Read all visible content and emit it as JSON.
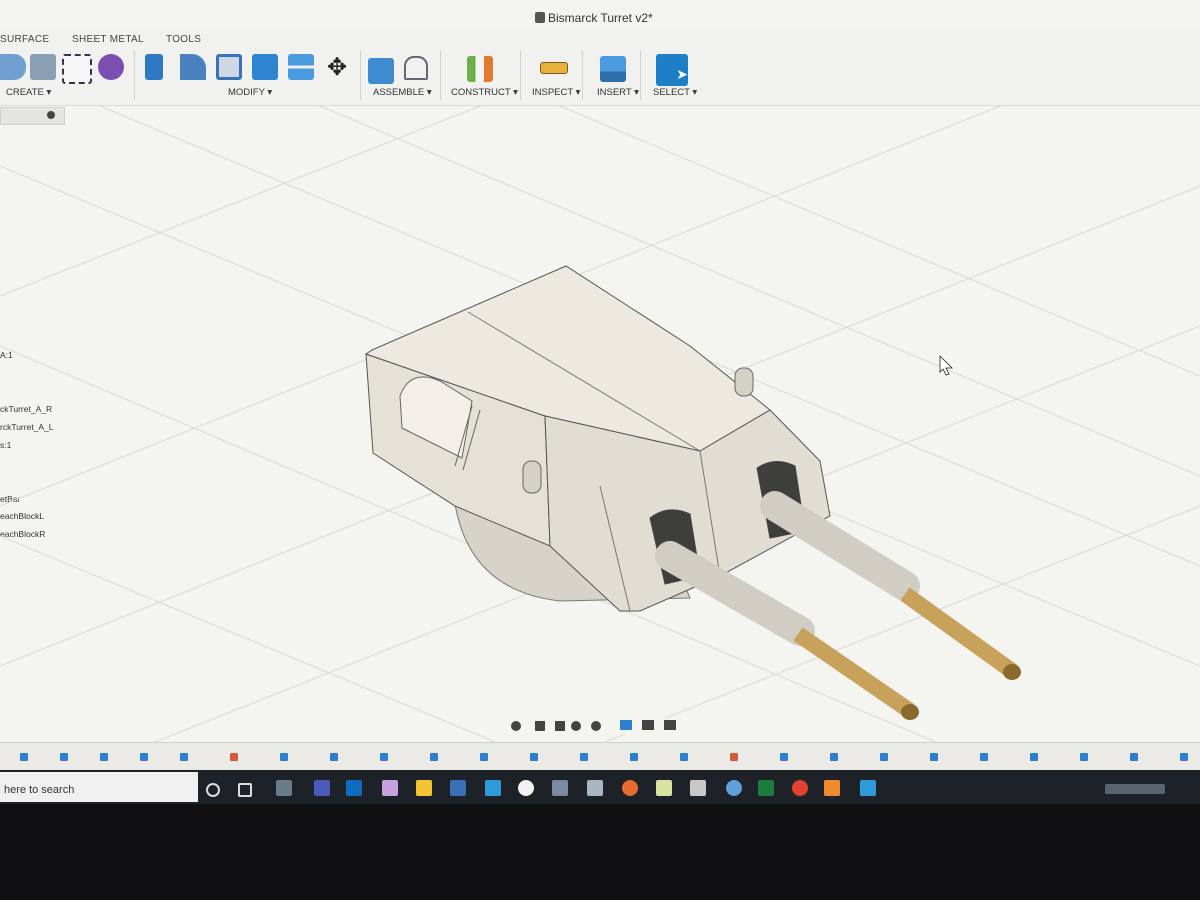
{
  "window": {
    "title": "Bismarck Turret v2*"
  },
  "tabs": [
    "SURFACE",
    "SHEET METAL",
    "TOOLS"
  ],
  "toolbar_groups": [
    "CREATE",
    "MODIFY",
    "ASSEMBLE",
    "CONSTRUCT",
    "INSPECT",
    "INSERT",
    "SELECT"
  ],
  "browser_items": [
    "A:1",
    "ckTurret_A_R",
    "rckTurret_A_L",
    "s:1",
    "etBar",
    "eachBlockL",
    "eachBlockR"
  ],
  "taskbar": {
    "search_placeholder": "here to search"
  },
  "colors": {
    "accent": "#1e7fc8",
    "barrel": "#c8a15a",
    "turret": "#dedbd0"
  }
}
